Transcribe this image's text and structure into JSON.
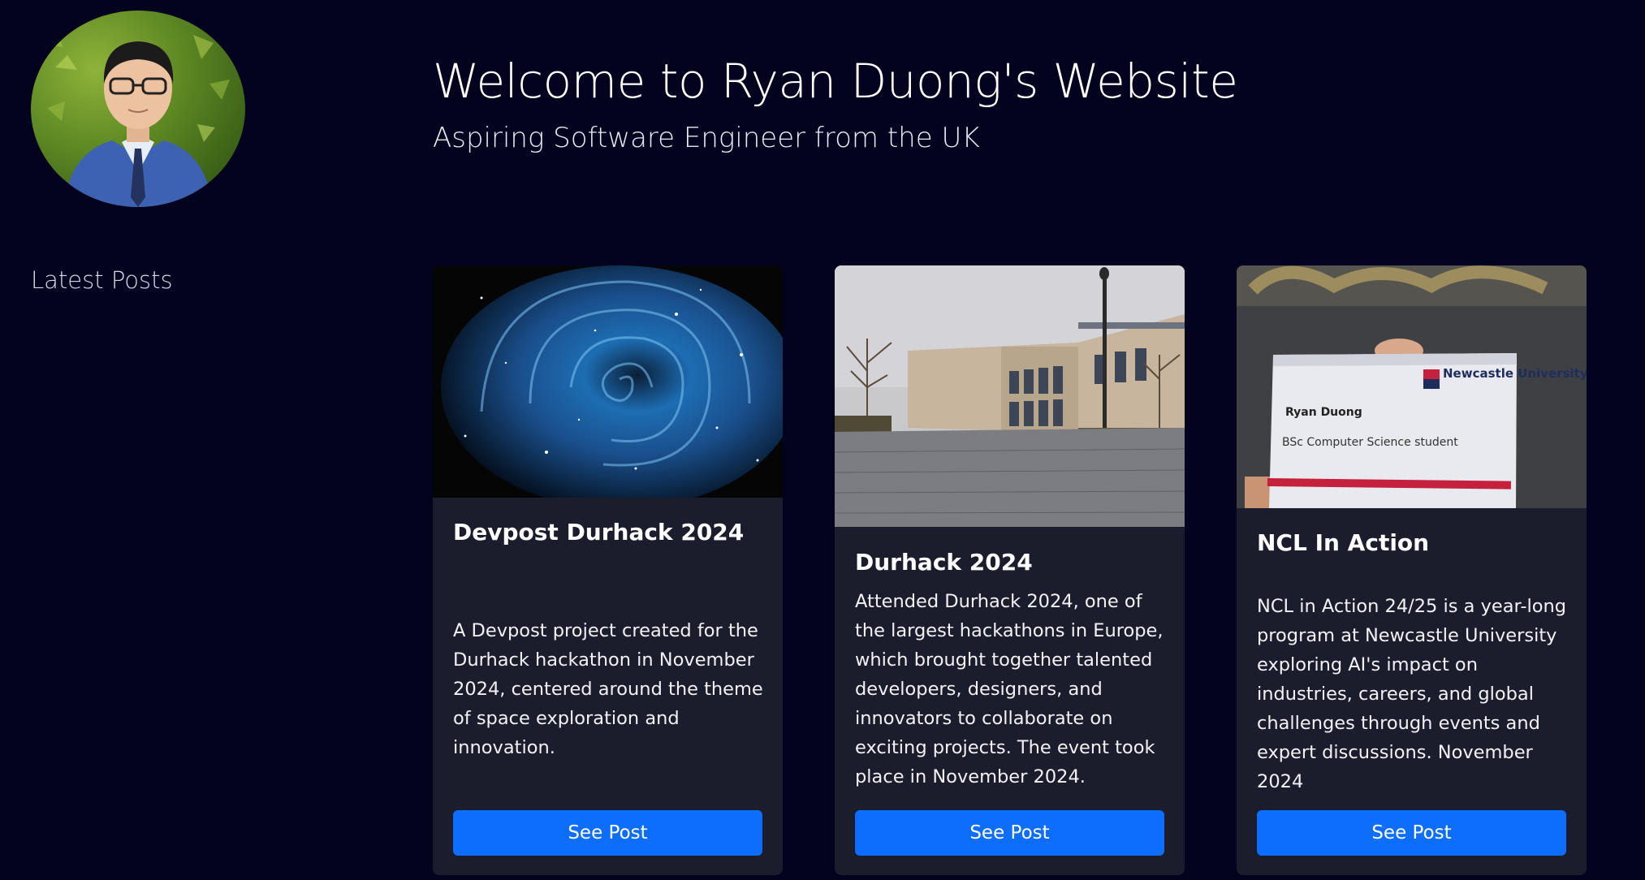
{
  "header": {
    "title": "Welcome to Ryan Duong's Website",
    "subtitle": "Aspiring Software Engineer from the UK"
  },
  "sidebar": {
    "avatar_icon": "profile-photo",
    "latest_posts_label": "Latest Posts"
  },
  "posts": [
    {
      "image": "blue-galaxy-rose-image",
      "title": "Devpost Durhack 2024",
      "description": "A Devpost project created for the Durhack hackathon in November 2024, centered around the theme of space exploration and innovation.",
      "button_label": "See Post"
    },
    {
      "image": "university-building-image",
      "title": "Durhack 2024",
      "description": "Attended Durhack 2024, one of the largest hackathons in Europe, which brought together talented developers, designers, and innovators to collaborate on exciting projects. The event took place in November 2024.",
      "button_label": "See Post"
    },
    {
      "image": "newcastle-university-badge-image",
      "title": "NCL In Action",
      "description": "NCL in Action 24/25 is a year-long program at Newcastle University exploring AI's impact on industries, careers, and global challenges through events and expert discussions. November 2024",
      "button_label": "See Post",
      "image_text": {
        "university": "Newcastle University",
        "name": "Ryan Duong",
        "role": "BSc Computer Science student"
      }
    }
  ],
  "colors": {
    "background": "#03031f",
    "card_background": "#1b1c2c",
    "button": "#0d6efd",
    "text": "#ffffff"
  }
}
